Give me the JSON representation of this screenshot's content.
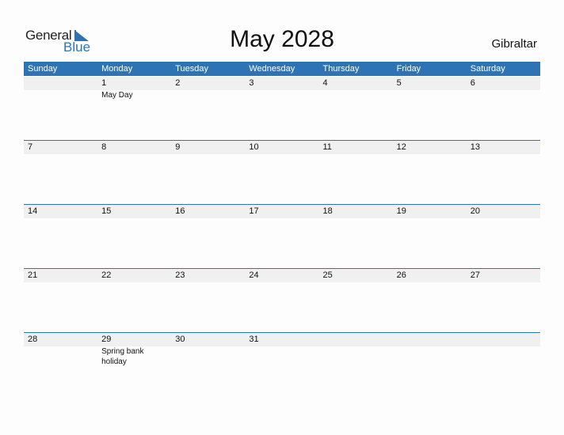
{
  "logo": {
    "word1": "General",
    "word2": "Blue",
    "brand_color": "#2e74b5"
  },
  "title": "May 2028",
  "country": "Gibraltar",
  "colors": {
    "header_bg": "#2e74b5",
    "row_band": "#f0f0f0"
  },
  "weekdays": [
    "Sunday",
    "Monday",
    "Tuesday",
    "Wednesday",
    "Thursday",
    "Friday",
    "Saturday"
  ],
  "weeks": [
    {
      "days": [
        {
          "num": "",
          "holiday": ""
        },
        {
          "num": "1",
          "holiday": "May Day"
        },
        {
          "num": "2",
          "holiday": ""
        },
        {
          "num": "3",
          "holiday": ""
        },
        {
          "num": "4",
          "holiday": ""
        },
        {
          "num": "5",
          "holiday": ""
        },
        {
          "num": "6",
          "holiday": ""
        }
      ]
    },
    {
      "days": [
        {
          "num": "7",
          "holiday": ""
        },
        {
          "num": "8",
          "holiday": ""
        },
        {
          "num": "9",
          "holiday": ""
        },
        {
          "num": "10",
          "holiday": ""
        },
        {
          "num": "11",
          "holiday": ""
        },
        {
          "num": "12",
          "holiday": ""
        },
        {
          "num": "13",
          "holiday": ""
        }
      ]
    },
    {
      "days": [
        {
          "num": "14",
          "holiday": ""
        },
        {
          "num": "15",
          "holiday": ""
        },
        {
          "num": "16",
          "holiday": ""
        },
        {
          "num": "17",
          "holiday": ""
        },
        {
          "num": "18",
          "holiday": ""
        },
        {
          "num": "19",
          "holiday": ""
        },
        {
          "num": "20",
          "holiday": ""
        }
      ]
    },
    {
      "days": [
        {
          "num": "21",
          "holiday": ""
        },
        {
          "num": "22",
          "holiday": ""
        },
        {
          "num": "23",
          "holiday": ""
        },
        {
          "num": "24",
          "holiday": ""
        },
        {
          "num": "25",
          "holiday": ""
        },
        {
          "num": "26",
          "holiday": ""
        },
        {
          "num": "27",
          "holiday": ""
        }
      ]
    },
    {
      "days": [
        {
          "num": "28",
          "holiday": ""
        },
        {
          "num": "29",
          "holiday": "Spring bank holiday"
        },
        {
          "num": "30",
          "holiday": ""
        },
        {
          "num": "31",
          "holiday": ""
        },
        {
          "num": "",
          "holiday": ""
        },
        {
          "num": "",
          "holiday": ""
        },
        {
          "num": "",
          "holiday": ""
        }
      ]
    }
  ]
}
